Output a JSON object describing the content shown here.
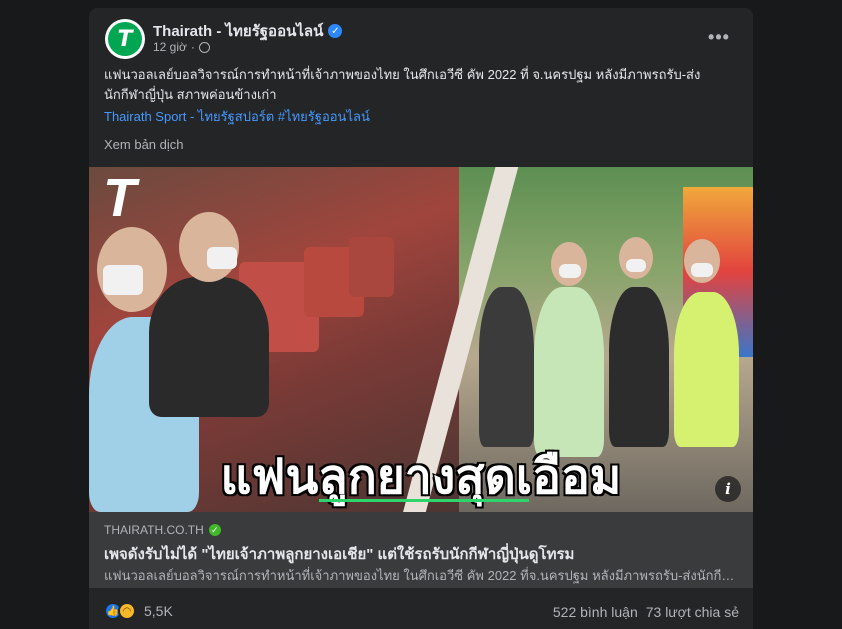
{
  "post": {
    "page_name": "Thairath - ไทยรัฐออนไลน์",
    "time": "12 giờ",
    "text": "แฟนวอลเลย์บอลวิจารณ์การทำหน้าที่เจ้าภาพของไทย ในศึกเอวีซี คัพ 2022 ที่ จ.นครปฐม หลังมีภาพรถรับ-ส่ง นักกีฬาญี่ปุ่น สภาพค่อนข้างเก่า",
    "tags": "Thairath Sport - ไทยรัฐสปอร์ต #ไทยรัฐออนไลน์",
    "translate_label": "Xem bản dịch",
    "more_label": "•••"
  },
  "image": {
    "logo_text": "T",
    "headline": "แฟนลูกยางสุดเอือม",
    "info_label": "i"
  },
  "link": {
    "domain": "THAIRATH.CO.TH",
    "title": "เพจดังรับไม่ได้ \"ไทยเจ้าภาพลูกยางเอเชีย\" แต่ใช้รถรับนักกีฬาญี่ปุ่นดูโทรม",
    "description": "แฟนวอลเลย์บอลวิจารณ์การทำหน้าที่เจ้าภาพของไทย ในศึกเอวีซี คัพ 2022 ที่จ.นครปฐม หลังมีภาพรถรับ-ส่งนักกีฬาญี่ปุ่น สภาพค่อนข้างเก่า"
  },
  "footer": {
    "reaction_count": "5,5K",
    "comments": "522 bình luận",
    "shares": "73 lượt chia sẻ"
  },
  "icons": {
    "avatar": "thairath-logo-icon",
    "verified": "verified-badge-icon",
    "globe": "globe-icon",
    "like": "like-reaction-icon",
    "haha": "haha-reaction-icon"
  },
  "colors": {
    "background": "#18191a",
    "card": "#242526",
    "link_box": "#3a3b3c",
    "accent": "#2d88ff",
    "brand_green": "#00a651"
  }
}
